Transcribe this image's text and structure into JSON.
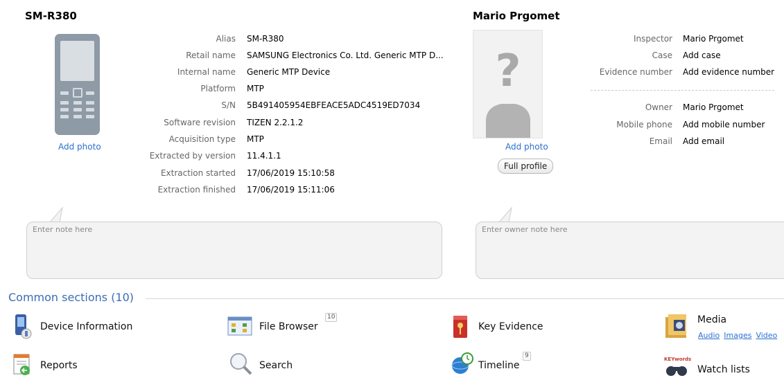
{
  "device": {
    "title": "SM-R380",
    "add_photo": "Add photo",
    "fields": [
      {
        "label": "Alias",
        "value": "SM-R380"
      },
      {
        "label": "Retail name",
        "value": "SAMSUNG Electronics Co. Ltd.  Generic MTP D..."
      },
      {
        "label": "Internal name",
        "value": "Generic MTP Device"
      },
      {
        "label": "Platform",
        "value": "MTP"
      },
      {
        "label": "S/N",
        "value": "5B491405954EBFEACE5ADC4519ED7034"
      },
      {
        "label": "Software revision",
        "value": "TIZEN 2.2.1.2"
      },
      {
        "label": "Acquisition type",
        "value": "MTP"
      },
      {
        "label": "Extracted by version",
        "value": "11.4.1.1"
      },
      {
        "label": "Extraction started",
        "value": "17/06/2019 15:10:58"
      },
      {
        "label": "Extraction finished",
        "value": "17/06/2019 15:11:06"
      }
    ],
    "note_placeholder": "Enter note here"
  },
  "owner": {
    "title": "Mario Prgomet",
    "add_photo": "Add photo",
    "full_profile": "Full profile",
    "fields": [
      {
        "label": "Inspector",
        "value": "Mario Prgomet",
        "link": false
      },
      {
        "label": "Case",
        "value": "Add case",
        "link": true
      },
      {
        "label": "Evidence number",
        "value": "Add evidence number",
        "link": true
      },
      {
        "label": "Owner",
        "value": "Mario Prgomet",
        "link": false
      },
      {
        "label": "Mobile phone",
        "value": "Add mobile number",
        "link": true
      },
      {
        "label": "Email",
        "value": "Add email",
        "link": true
      }
    ],
    "note_placeholder": "Enter owner note here"
  },
  "common": {
    "title": "Common sections (10)",
    "sections": [
      {
        "label": "Device Information",
        "icon": "device-info-icon"
      },
      {
        "label": "File Browser",
        "icon": "file-browser-icon",
        "badge": "10"
      },
      {
        "label": "Key Evidence",
        "icon": "key-evidence-icon"
      },
      {
        "label": "Media",
        "icon": "media-icon"
      },
      {
        "label": "Reports",
        "icon": "reports-icon"
      },
      {
        "label": "Search",
        "icon": "search-icon"
      },
      {
        "label": "Timeline",
        "icon": "timeline-icon",
        "badge": "9"
      },
      {
        "label": "Watch lists",
        "icon": "watch-lists-icon",
        "icon_text": "KEYwords"
      }
    ],
    "media_links": [
      "Audio",
      "Images",
      "Video"
    ]
  },
  "colors": {
    "link": "#2a6fcf",
    "section_title": "#3b6db5",
    "phone_body": "#8e9aa6"
  }
}
